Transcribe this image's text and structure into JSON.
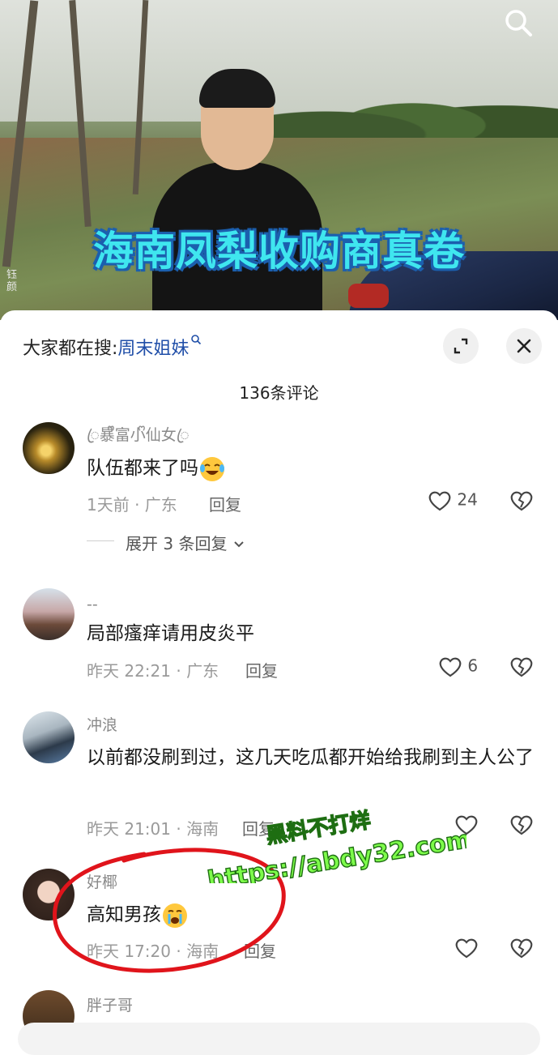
{
  "video": {
    "title": "海南凤梨收购商真卷",
    "corner_text": "钰\n颜",
    "icons": {
      "search": "search-icon"
    }
  },
  "header": {
    "hot_search_prefix": "大家都在搜:",
    "hot_search_keyword": "周末姐妹",
    "comment_count": "136条评论",
    "icons": {
      "expand": "expand-icon",
      "close": "close-icon"
    }
  },
  "comments": [
    {
      "name": "ꦿ暴ᩚ富小ᩚ仙女ꦿ",
      "text": "队伍都来了吗",
      "emoji": "laughing-crying-emoji",
      "time_location": "1天前 · 广东",
      "reply_label": "回复",
      "likes": "24",
      "expand_label": "展开 3 条回复"
    },
    {
      "name": "--",
      "text": "局部瘙痒请用皮炎平",
      "time_location": "昨天 22:21 · 广东",
      "reply_label": "回复",
      "likes": "6"
    },
    {
      "name": "冲浪",
      "text": "以前都没刷到过，这几天吃瓜都开始给我刷到主人公了",
      "time_location": "昨天 21:01 · 海南",
      "reply_label": "回复",
      "likes": ""
    },
    {
      "name": "好椰",
      "text": "高知男孩",
      "emoji": "crying-emoji",
      "time_location": "昨天 17:20 · 海南",
      "reply_label": "回复",
      "likes": ""
    },
    {
      "name": "胖子哥"
    }
  ],
  "overlay": {
    "line1": "黑料不打烊",
    "line2": "https://abdy32.com"
  },
  "colors": {
    "title_fill": "#3fe6ef",
    "title_stroke": "#1b5fae",
    "keyword": "#1f4ea8",
    "annotation_red": "#e0141b",
    "overlay_green": "#7dfb4a"
  }
}
